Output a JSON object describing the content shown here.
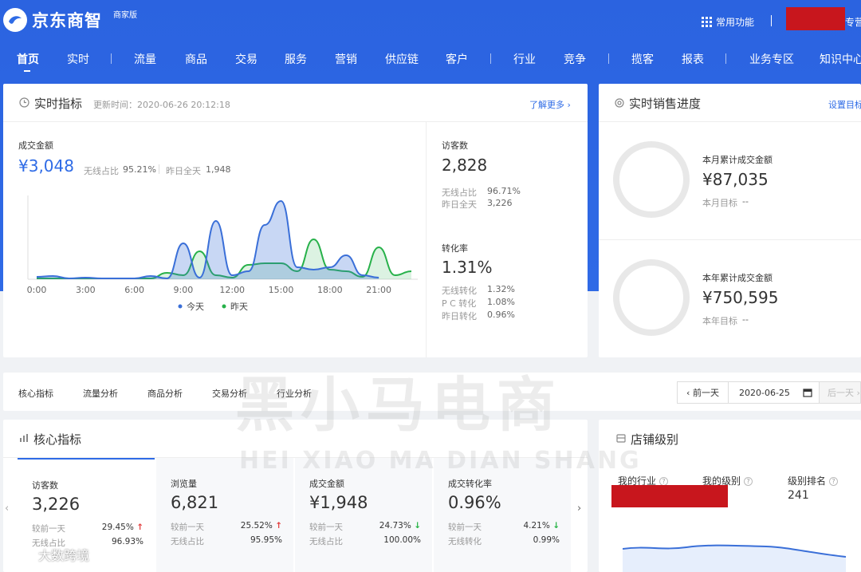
{
  "header": {
    "brand": "京东商智",
    "edition": "商家版",
    "common_functions": "常用功能",
    "user_suffix": "专营"
  },
  "nav": {
    "items": [
      "首页",
      "实时",
      "流量",
      "商品",
      "交易",
      "服务",
      "营销",
      "供应链",
      "客户",
      "行业",
      "竞争",
      "揽客",
      "报表",
      "业务专区",
      "知识中心"
    ],
    "active": "首页"
  },
  "realtime": {
    "title": "实时指标",
    "update_time": "更新时间：2020-06-26 20:12:18",
    "learn_more": "了解更多 ›",
    "gmv_label": "成交金额",
    "gmv_value": "¥3,048",
    "wireless_ratio_label": "无线占比",
    "wireless_ratio_value": "95.21%",
    "yesterday_label": "昨日全天",
    "yesterday_value": "1,948",
    "visitors_label": "访客数",
    "visitors_value": "2,828",
    "visitors_wireless_label": "无线占比",
    "visitors_wireless_value": "96.71%",
    "visitors_yesterday_label": "昨日全天",
    "visitors_yesterday_value": "3,226",
    "conv_label": "转化率",
    "conv_value": "1.31%",
    "conv_wireless_label": "无线转化",
    "conv_wireless_value": "1.32%",
    "conv_pc_label": "P C 转化",
    "conv_pc_value": "1.08%",
    "conv_yesterday_label": "昨日转化",
    "conv_yesterday_value": "0.96%"
  },
  "chart_data": {
    "type": "area",
    "x_ticks": [
      "0:00",
      "3:00",
      "6:00",
      "9:00",
      "12:00",
      "15:00",
      "18:00",
      "21:00"
    ],
    "x": [
      0,
      1,
      2,
      3,
      4,
      5,
      6,
      7,
      8,
      9,
      10,
      11,
      12,
      13,
      14,
      15,
      16,
      17,
      18,
      19,
      20,
      21,
      22,
      23
    ],
    "ylim": [
      0,
      1
    ],
    "series": [
      {
        "name": "今天",
        "color": "#3a6fd8",
        "values": [
          0.03,
          0.04,
          0.01,
          0.02,
          0.01,
          0.01,
          0.01,
          0.04,
          0.01,
          0.45,
          0.02,
          0.73,
          0.05,
          0.1,
          0.68,
          0.98,
          0.15,
          0.12,
          0.15,
          0.3,
          0.05,
          0.02,
          null,
          null
        ]
      },
      {
        "name": "昨天",
        "color": "#27b14a",
        "values": [
          0.01,
          0.01,
          0.01,
          0.01,
          0.01,
          0.01,
          0.01,
          0.01,
          0.08,
          0.05,
          0.35,
          0.05,
          0.02,
          0.18,
          0.2,
          0.2,
          0.1,
          0.5,
          0.12,
          0.1,
          0.03,
          0.4,
          0.05,
          0.1
        ]
      }
    ],
    "legend": "bottom"
  },
  "sales_progress": {
    "title": "实时销售进度",
    "set_target": "设置目标",
    "month_label": "本月累计成交金额",
    "month_value": "¥87,035",
    "month_target_label": "本月目标",
    "month_target_value": "--",
    "year_label": "本年累计成交金额",
    "year_value": "¥750,595",
    "year_target_label": "本年目标",
    "year_target_value": "--"
  },
  "analysis_tabs": {
    "items": [
      "核心指标",
      "流量分析",
      "商品分析",
      "交易分析",
      "行业分析"
    ],
    "prev_day": "‹ 前一天",
    "date": "2020-06-25",
    "next_day": "后一天 ›"
  },
  "core": {
    "title": "核心指标",
    "compare_label": "较前一天",
    "metrics": [
      {
        "label": "访客数",
        "value": "3,226",
        "change": "29.45%",
        "dir": "↑",
        "sub_label": "无线占比",
        "sub_value": "96.93%"
      },
      {
        "label": "浏览量",
        "value": "6,821",
        "change": "25.52%",
        "dir": "↑",
        "sub_label": "无线占比",
        "sub_value": "95.95%"
      },
      {
        "label": "成交金额",
        "value": "¥1,948",
        "change": "24.73%",
        "dir": "↓",
        "sub_label": "无线占比",
        "sub_value": "100.00%"
      },
      {
        "label": "成交转化率",
        "value": "0.96%",
        "change": "4.21%",
        "dir": "↓",
        "sub_label": "无线转化",
        "sub_value": "0.99%"
      }
    ]
  },
  "store_level": {
    "title": "店铺级别",
    "industry_label": "我的行业",
    "level_label": "我的级别",
    "rank_label": "级别排名",
    "rank_value": "241"
  },
  "watermark": {
    "big": "黑小马电商",
    "small": "HEI XIAO MA DIAN SHANG",
    "corner": "大数跨境"
  },
  "colors": {
    "brand_blue": "#2e6be6",
    "up_red": "#e23c3c",
    "down_green": "#28b446",
    "redact": "#c8161d"
  }
}
